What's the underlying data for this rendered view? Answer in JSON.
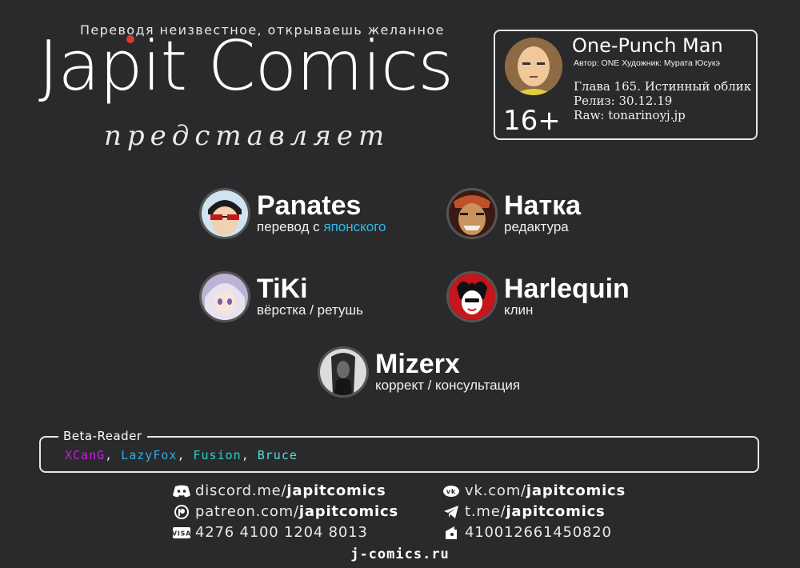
{
  "header": {
    "tagline": "Переводя неизвестное, открываешь желанное",
    "brand": "Japit Comics",
    "presents": "представляет"
  },
  "info_card": {
    "title": "One-Punch Man",
    "credits": "Автор: ONE Художник:  Мурата Юсукэ",
    "chapter": "Глава 165. Истинный облик",
    "release": "Релиз: 30.12.19",
    "raw": "Raw: tonarinoyj.jp",
    "age_rating": "16+"
  },
  "team": [
    {
      "name": "Panates",
      "role_prefix": "перевод с ",
      "role_highlight": "японского",
      "role": ""
    },
    {
      "name": "Натка",
      "role": "редактура"
    },
    {
      "name": "TiKi",
      "role": "вёрстка / ретушь"
    },
    {
      "name": "Harlequin",
      "role": "клин"
    },
    {
      "name": "Mizerx",
      "role": "коррект / консультация"
    }
  ],
  "beta": {
    "label": "Beta-Reader",
    "readers": [
      {
        "name": "XCanG",
        "color": "#c81edc"
      },
      {
        "name": "LazyFox",
        "color": "#2ab0e6"
      },
      {
        "name": "Fusion",
        "color": "#2ad0c8"
      },
      {
        "name": "Bruce",
        "color": "#4ee0d8"
      }
    ],
    "separator": ", "
  },
  "links": {
    "discord": {
      "prefix": "discord.me/",
      "bold": "japitcomics",
      "icon": "discord-icon"
    },
    "vk": {
      "prefix": "vk.com/",
      "bold": "japitcomics",
      "icon": "vk-icon"
    },
    "patreon": {
      "prefix": "patreon.com/",
      "bold": "japitcomics",
      "icon": "patreon-icon"
    },
    "telegram": {
      "prefix": "t.me/",
      "bold": "japitcomics",
      "icon": "telegram-icon"
    },
    "visa": {
      "text": "4276 4100 1204 8013",
      "icon": "visa-icon"
    },
    "yandex": {
      "text": "410012661450820",
      "icon": "yandex-money-icon"
    },
    "site": "j-comics.ru"
  }
}
